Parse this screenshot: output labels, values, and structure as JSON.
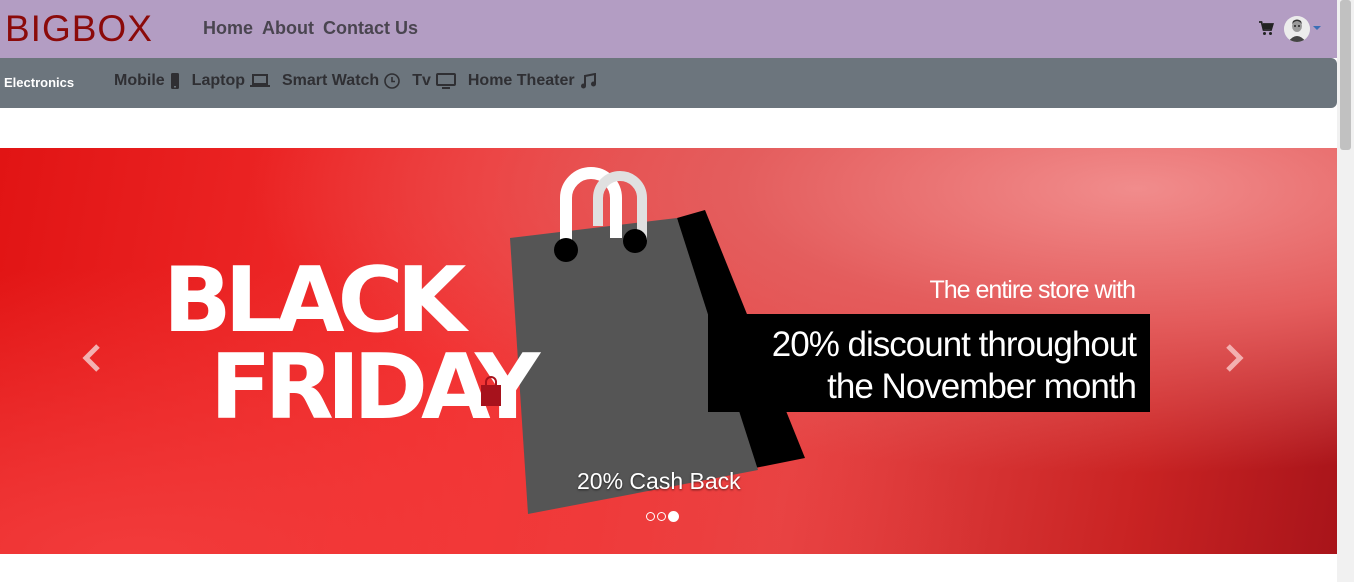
{
  "brand": "BIGBOX",
  "nav": {
    "home": "Home",
    "about": "About",
    "contact": "Contact Us",
    "cart_icon": "cart-icon",
    "avatar_icon": "user-avatar"
  },
  "categories": {
    "title": "Electronics",
    "items": [
      {
        "label": "Mobile",
        "icon": "mobile-icon"
      },
      {
        "label": "Laptop",
        "icon": "laptop-icon"
      },
      {
        "label": "Smart Watch",
        "icon": "clock-icon"
      },
      {
        "label": "Tv",
        "icon": "tv-icon"
      },
      {
        "label": "Home Theater",
        "icon": "music-icon"
      }
    ]
  },
  "carousel": {
    "headline_line1": "BLACK",
    "headline_line2": "FRIDAY",
    "store_line": "The entire store with",
    "discount_line1": "20% discount throughout",
    "discount_line2": "the November month",
    "caption": "20% Cash Back",
    "slide_count": 3,
    "active_slide": 3
  },
  "colors": {
    "nav_bg": "#b39dc3",
    "brand": "#8b0a0a",
    "category_bar": "#6c757d",
    "banner_red": "#e11414"
  }
}
